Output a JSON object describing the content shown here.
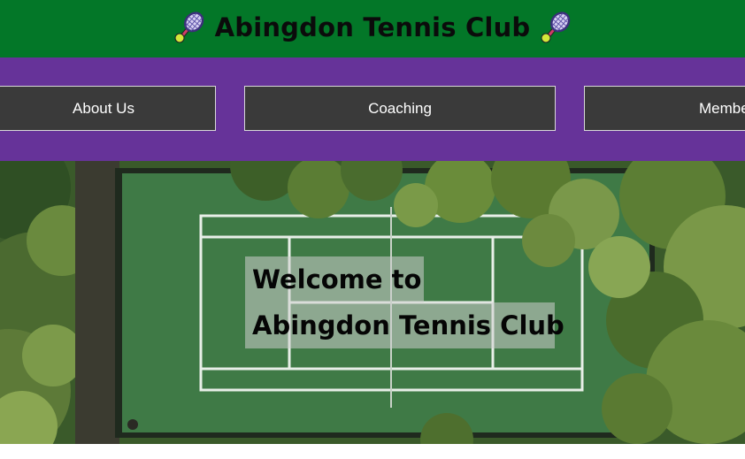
{
  "header": {
    "title": "Abingdon Tennis Club",
    "background_color": "#037728",
    "icons": [
      "tennis-racket-icon",
      "tennis-racket-icon"
    ]
  },
  "nav": {
    "background_color": "#663399",
    "items": [
      {
        "label": "About Us"
      },
      {
        "label": "Coaching"
      },
      {
        "label": "Membe"
      }
    ]
  },
  "hero": {
    "image": "aerial-tennis-court-photo",
    "welcome_line_1": "Welcome to",
    "welcome_line_2": "Abingdon Tennis Club"
  }
}
